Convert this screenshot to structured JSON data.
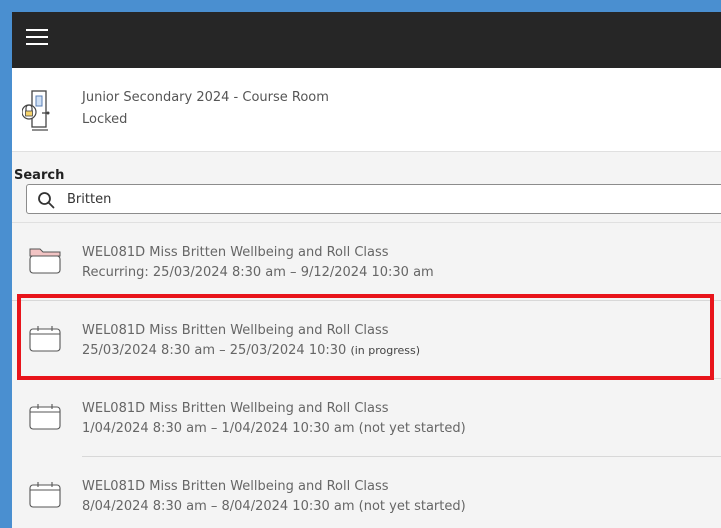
{
  "menu": {
    "icon": "hamburger-menu-icon"
  },
  "course_room": {
    "icon": "locked-door-icon",
    "title": "Junior Secondary 2024 - Course Room",
    "status": "Locked"
  },
  "search": {
    "label": "Search",
    "value": "Britten",
    "icon": "search-icon"
  },
  "results": [
    {
      "icon": "folder-icon",
      "title": "WEL081D Miss Britten Wellbeing and Roll Class",
      "time": "Recurring: 25/03/2024 8:30 am – 9/12/2024 10:30 am",
      "status": ""
    },
    {
      "icon": "calendar-icon",
      "title": "WEL081D Miss Britten Wellbeing and Roll Class",
      "time": "25/03/2024 8:30 am – 25/03/2024 10:30 ",
      "status": "(in progress)"
    },
    {
      "icon": "calendar-icon",
      "title": "WEL081D Miss Britten Wellbeing and Roll Class",
      "time": "1/04/2024 8:30 am – 1/04/2024 10:30 am (not yet started)",
      "status": ""
    },
    {
      "icon": "calendar-icon",
      "title": "WEL081D Miss Britten Wellbeing and Roll Class",
      "time": "8/04/2024 8:30 am – 8/04/2024 10:30 am (not yet started)",
      "status": ""
    }
  ],
  "colors": {
    "frame": "#4a8fd0",
    "topbar": "#262626",
    "highlight": "#e8141b",
    "folder_tab": "#f2c4c4"
  }
}
